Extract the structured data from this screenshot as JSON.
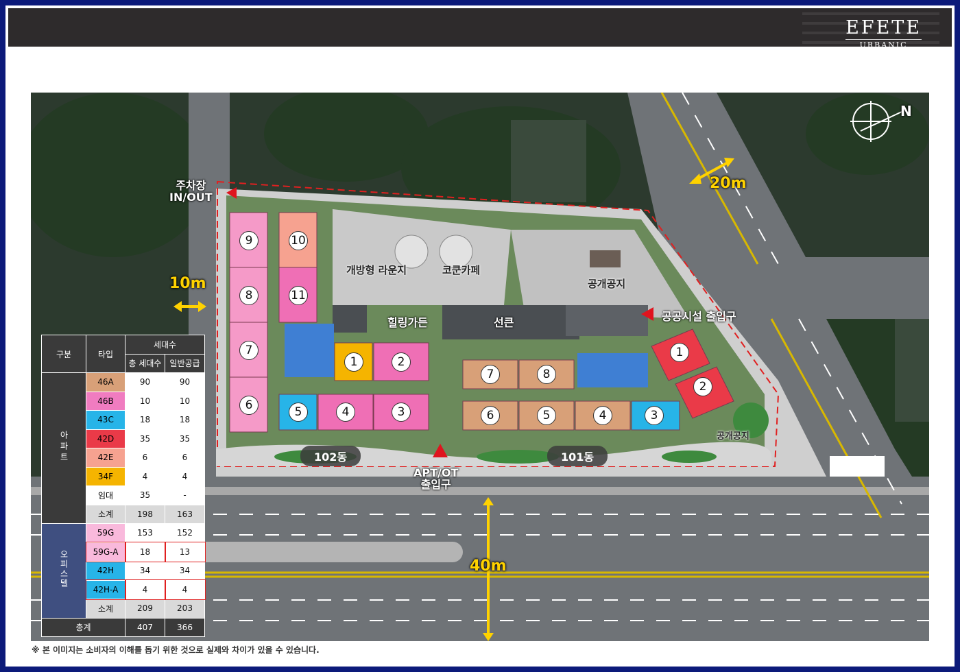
{
  "brand": {
    "line1": "EFETE",
    "line2": "URBANIC"
  },
  "map_labels": {
    "parking": "주차장\nIN/OUT",
    "lounge": "개방형 라운지",
    "cafe": "코쿤카페",
    "garden": "힐링가든",
    "sunken": "선큰",
    "open_space_top": "공개공지",
    "open_space_right": "공개공지",
    "public_entrance": "공공시설 출입구",
    "apt_entrance": "APT/OT\n출입구",
    "dong_102": "102동",
    "dong_101": "101동",
    "north": "N"
  },
  "road_widths": {
    "w20": "20m",
    "w10": "10m",
    "w40": "40m"
  },
  "buildings": [
    {
      "label": "9",
      "color": "#f59ac8"
    },
    {
      "label": "10",
      "color": "#f6a290"
    },
    {
      "label": "8",
      "color": "#f59ac8"
    },
    {
      "label": "11",
      "color": "#ef6fb5"
    },
    {
      "label": "7",
      "color": "#f59ac8"
    },
    {
      "label": "6",
      "color": "#f59ac8"
    },
    {
      "label": "1",
      "color": "#f5b400"
    },
    {
      "label": "2",
      "color": "#ef6fb5"
    },
    {
      "label": "5",
      "color": "#27b4e8"
    },
    {
      "label": "4",
      "color": "#ef6fb5"
    },
    {
      "label": "3",
      "color": "#ef6fb5"
    },
    {
      "label": "7",
      "color": "#d8a078"
    },
    {
      "label": "8",
      "color": "#d8a078"
    },
    {
      "label": "6",
      "color": "#d8a078"
    },
    {
      "label": "5",
      "color": "#d8a078"
    },
    {
      "label": "4",
      "color": "#d8a078"
    },
    {
      "label": "3",
      "color": "#27b4e8"
    },
    {
      "label": "1",
      "color": "#ea3a48"
    },
    {
      "label": "2",
      "color": "#ea3a48"
    }
  ],
  "table": {
    "headers": {
      "category": "구분",
      "type": "타입",
      "units": "세대수",
      "total_units": "총 세대수",
      "general_supply": "일반공급"
    },
    "apartment": {
      "label": "아파트",
      "rows": [
        {
          "type": "46A",
          "total": "90",
          "general": "90",
          "color": "#d8a078"
        },
        {
          "type": "46B",
          "total": "10",
          "general": "10",
          "color": "#f07cc0"
        },
        {
          "type": "43C",
          "total": "18",
          "general": "18",
          "color": "#27b4e8"
        },
        {
          "type": "42D",
          "total": "35",
          "general": "35",
          "color": "#ea3a48"
        },
        {
          "type": "42E",
          "total": "6",
          "general": "6",
          "color": "#f6a290"
        },
        {
          "type": "34F",
          "total": "4",
          "general": "4",
          "color": "#f5b400"
        },
        {
          "type": "임대",
          "total": "35",
          "general": "-",
          "color": "#ffffff"
        }
      ],
      "subtotal": {
        "label": "소계",
        "total": "198",
        "general": "163"
      }
    },
    "officetel": {
      "label": "오피스텔",
      "rows": [
        {
          "type": "59G",
          "total": "153",
          "general": "152",
          "color": "#f9b9dc"
        },
        {
          "type": "59G-A",
          "total": "18",
          "general": "13",
          "color": "#f9b9dc"
        },
        {
          "type": "42H",
          "total": "34",
          "general": "34",
          "color": "#27b4e8"
        },
        {
          "type": "42H-A",
          "total": "4",
          "general": "4",
          "color": "#27b4e8"
        }
      ],
      "subtotal": {
        "label": "소계",
        "total": "209",
        "general": "203"
      }
    },
    "grand_total": {
      "label": "총계",
      "total": "407",
      "general": "366"
    }
  },
  "footnote": "※ 본 이미지는 소비자의 이해를 돕기 위한 것으로 실제와 차이가 있을 수 있습니다."
}
